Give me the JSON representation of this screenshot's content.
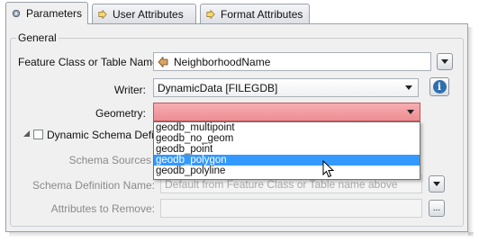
{
  "tabs": [
    {
      "label": "Parameters",
      "active": true,
      "icon": "gear-icon"
    },
    {
      "label": "User Attributes",
      "active": false,
      "icon": "arrow-right-icon"
    },
    {
      "label": "Format Attributes",
      "active": false,
      "icon": "arrow-right-icon"
    }
  ],
  "general": {
    "group_label": "General",
    "feature_class_label": "Feature Class or Table Name:",
    "feature_class_value": "NeighborhoodName",
    "writer_label": "Writer:",
    "writer_value": "DynamicData [FILEGDB]",
    "geometry_label": "Geometry:",
    "geometry_value": "",
    "geometry_state_color": "#ec8d92",
    "geometry_options": [
      "geodb_multipoint",
      "geodb_no_geom",
      "geodb_point",
      "geodb_polygon",
      "geodb_polyline"
    ],
    "geometry_highlighted": "geodb_polygon"
  },
  "dynamic_schema": {
    "label": "Dynamic Schema Definiti",
    "checked": false,
    "schema_sources_label": "Schema Sources",
    "schema_definition_label": "Schema Definition Name:",
    "schema_definition_placeholder": "Default from Feature Class or Table name above",
    "attributes_remove_label": "Attributes to Remove:",
    "attributes_remove_value": "",
    "ellipsis_label": "..."
  },
  "icons": {
    "feature_arrow": "arrow-left-icon",
    "info": "info-icon"
  },
  "colors": {
    "selection": "#3399ff",
    "info_blue": "#2f6fb0"
  }
}
